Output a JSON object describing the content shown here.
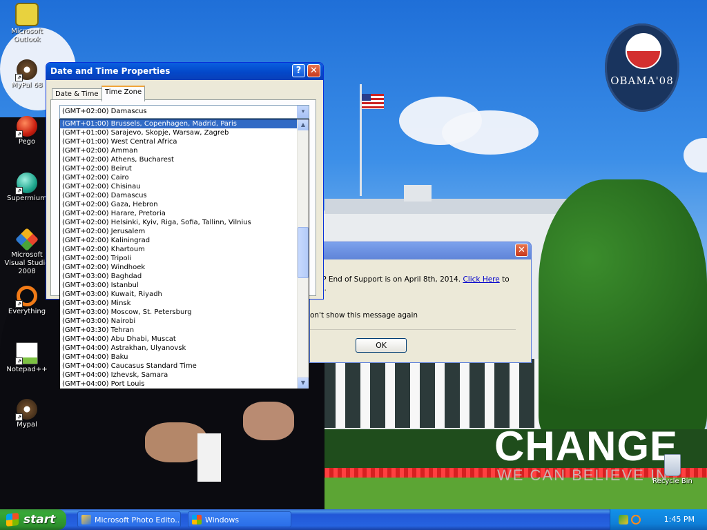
{
  "desktop": {
    "icons": [
      {
        "label": "Microsoft Outlook"
      },
      {
        "label": "MyPal 68"
      },
      {
        "label": "Pego"
      },
      {
        "label": "Supermium"
      },
      {
        "label": "Microsoft Visual Studio 2008"
      },
      {
        "label": "Everything"
      },
      {
        "label": "Notepad++"
      },
      {
        "label": "Mypal"
      },
      {
        "label": "Recycle Bin"
      }
    ],
    "wallpaper": {
      "logo_text": "OBAMA'08",
      "headline": "CHANGE",
      "subheadline": "WE CAN BELIEVE IN"
    }
  },
  "datetime_dialog": {
    "title": "Date and Time Properties",
    "help_button": "?",
    "close_button": "✕",
    "tabs": [
      {
        "label": "Date & Time",
        "active": false
      },
      {
        "label": "Time Zone",
        "active": true
      }
    ],
    "timezone_combo": {
      "value": "(GMT+02:00) Damascus",
      "arrow": "▾"
    },
    "timezone_list": [
      "(GMT+01:00) Brussels, Copenhagen, Madrid, Paris",
      "(GMT+01:00) Sarajevo, Skopje, Warsaw, Zagreb",
      "(GMT+01:00) West Central Africa",
      "(GMT+02:00) Amman",
      "(GMT+02:00) Athens, Bucharest",
      "(GMT+02:00) Beirut",
      "(GMT+02:00) Cairo",
      "(GMT+02:00) Chisinau",
      "(GMT+02:00) Damascus",
      "(GMT+02:00) Gaza, Hebron",
      "(GMT+02:00) Harare, Pretoria",
      "(GMT+02:00) Helsinki, Kyiv, Riga, Sofia, Tallinn, Vilnius",
      "(GMT+02:00) Jerusalem",
      "(GMT+02:00) Kaliningrad",
      "(GMT+02:00) Khartoum",
      "(GMT+02:00) Tripoli",
      "(GMT+02:00) Windhoek",
      "(GMT+03:00) Baghdad",
      "(GMT+03:00) Istanbul",
      "(GMT+03:00) Kuwait, Riyadh",
      "(GMT+03:00) Minsk",
      "(GMT+03:00) Moscow, St. Petersburg",
      "(GMT+03:00) Nairobi",
      "(GMT+03:30) Tehran",
      "(GMT+04:00) Abu Dhabi, Muscat",
      "(GMT+04:00) Astrakhan, Ulyanovsk",
      "(GMT+04:00) Baku",
      "(GMT+04:00) Caucasus Standard Time",
      "(GMT+04:00) Izhevsk, Samara",
      "(GMT+04:00) Port Louis"
    ],
    "selected_index": 0,
    "scroll_up": "▲",
    "scroll_down": "▼"
  },
  "support_message": {
    "close_button": "✕",
    "text_before_link": "XP End of Support is on April 8th, 2014. ",
    "link_text": "Click Here",
    "text_after_link": " to",
    "text_line2": "re.",
    "checkbox_label": "on't show this message again",
    "ok_button": "OK"
  },
  "taskbar": {
    "start_label": "start",
    "tasks": [
      {
        "label": "Microsoft Photo Edito..."
      },
      {
        "label": "Windows"
      }
    ],
    "clock": "1:45 PM"
  },
  "colors": {
    "xp_title_blue": "#0348c9",
    "selection_blue": "#316ac5",
    "taskbar_blue": "#2663e0",
    "start_green": "#36a836"
  }
}
